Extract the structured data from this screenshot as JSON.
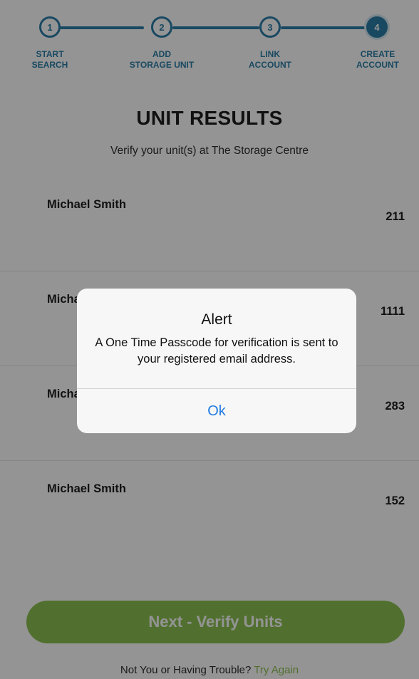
{
  "stepper": {
    "steps": [
      {
        "number": "1",
        "label": "START\nSEARCH"
      },
      {
        "number": "2",
        "label": "ADD\nSTORAGE UNIT"
      },
      {
        "number": "3",
        "label": "LINK\nACCOUNT"
      },
      {
        "number": "4",
        "label": "CREATE\nACCOUNT"
      }
    ],
    "active_step": 4,
    "accent_color": "#2b7fa8"
  },
  "header": {
    "title": "UNIT RESULTS",
    "subtitle": "Verify your unit(s) at The Storage Centre"
  },
  "results": [
    {
      "name": "Michael Smith",
      "unit": "211"
    },
    {
      "name": "Michael Smith",
      "unit": "1111"
    },
    {
      "name": "Michael Smith",
      "unit": "283"
    },
    {
      "name": "Michael Smith",
      "unit": "152"
    }
  ],
  "actions": {
    "next_label": "Next - Verify Units",
    "trouble_text": "Not You or Having Trouble?",
    "try_again_label": "Try Again",
    "button_color": "#8cc152"
  },
  "alert": {
    "title": "Alert",
    "message": "A One Time Passcode for verification is sent to your registered email address.",
    "ok_label": "Ok",
    "ok_color": "#1f7ae0"
  }
}
